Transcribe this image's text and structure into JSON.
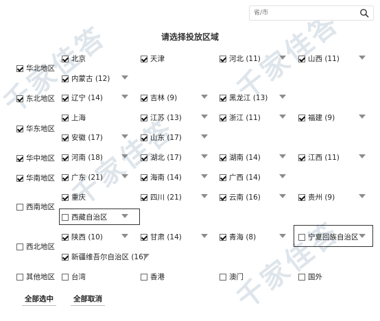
{
  "search": {
    "placeholder": "省/市"
  },
  "title": "请选择投放区域",
  "regions": [
    {
      "label": "华北地区",
      "checked": true
    },
    {
      "label": "东北地区",
      "checked": true
    },
    {
      "label": "华东地区",
      "checked": true
    },
    {
      "label": "华中地区",
      "checked": true
    },
    {
      "label": "华南地区",
      "checked": true
    },
    {
      "label": "西南地区",
      "checked": false
    },
    {
      "label": "西北地区",
      "checked": false
    },
    {
      "label": "其他地区",
      "checked": false
    }
  ],
  "provinces": [
    {
      "label": "北京",
      "checked": true,
      "arrow": false
    },
    {
      "label": "天津",
      "checked": true,
      "arrow": false
    },
    {
      "label": "河北 (11)",
      "checked": true,
      "arrow": true
    },
    {
      "label": "山西 (11)",
      "checked": true,
      "arrow": true
    },
    {
      "label": "内蒙古 (12)",
      "checked": true,
      "arrow": true
    },
    {
      "label": "辽宁 (14)",
      "checked": true,
      "arrow": true
    },
    {
      "label": "吉林 (9)",
      "checked": true,
      "arrow": true
    },
    {
      "label": "黑龙江 (13)",
      "checked": true,
      "arrow": true
    },
    {
      "label": "上海",
      "checked": true,
      "arrow": false
    },
    {
      "label": "江苏 (13)",
      "checked": true,
      "arrow": true
    },
    {
      "label": "浙江 (11)",
      "checked": true,
      "arrow": true
    },
    {
      "label": "福建 (9)",
      "checked": true,
      "arrow": true
    },
    {
      "label": "安徽 (17)",
      "checked": true,
      "arrow": true
    },
    {
      "label": "山东 (17)",
      "checked": true,
      "arrow": true
    },
    {
      "label": "河南 (18)",
      "checked": true,
      "arrow": true
    },
    {
      "label": "湖北 (17)",
      "checked": true,
      "arrow": true
    },
    {
      "label": "湖南 (14)",
      "checked": true,
      "arrow": true
    },
    {
      "label": "江西 (11)",
      "checked": true,
      "arrow": true
    },
    {
      "label": "广东 (21)",
      "checked": true,
      "arrow": true
    },
    {
      "label": "海南 (14)",
      "checked": true,
      "arrow": true
    },
    {
      "label": "广西 (14)",
      "checked": true,
      "arrow": true
    },
    {
      "label": "重庆",
      "checked": true,
      "arrow": false
    },
    {
      "label": "四川 (21)",
      "checked": true,
      "arrow": true
    },
    {
      "label": "云南 (16)",
      "checked": true,
      "arrow": true
    },
    {
      "label": "贵州 (9)",
      "checked": true,
      "arrow": true
    },
    {
      "label": "西藏自治区",
      "checked": false,
      "arrow": true
    },
    {
      "label": "陕西 (10)",
      "checked": true,
      "arrow": true
    },
    {
      "label": "甘肃 (14)",
      "checked": true,
      "arrow": true
    },
    {
      "label": "青海 (8)",
      "checked": true,
      "arrow": true
    },
    {
      "label": "宁夏回族自治区",
      "checked": false,
      "arrow": true
    },
    {
      "label": "新疆维吾尔自治区 (16)",
      "checked": true,
      "arrow": true
    },
    {
      "label": "台湾",
      "checked": false,
      "arrow": false
    },
    {
      "label": "香港",
      "checked": false,
      "arrow": false
    },
    {
      "label": "澳门",
      "checked": false,
      "arrow": false
    },
    {
      "label": "国外",
      "checked": false,
      "arrow": false
    }
  ],
  "buttons": {
    "select_all": "全部选中",
    "cancel_all": "全部取消"
  },
  "watermark": {
    "text": "千家佳答",
    "color": "#c4d0dc"
  },
  "icons": {
    "search": "search-icon",
    "arrow": "chevron-down-icon",
    "check": "checkmark"
  }
}
